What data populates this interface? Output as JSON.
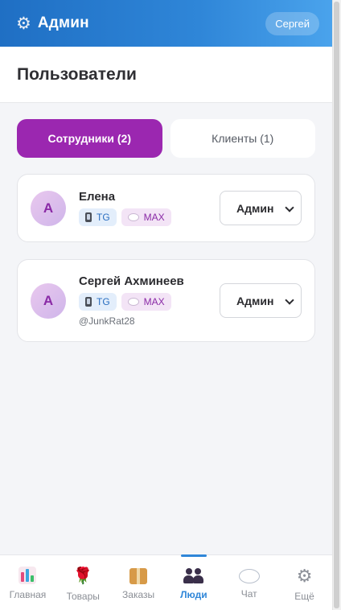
{
  "header": {
    "icon": "gear-icon",
    "title": "Админ",
    "user_label": "Сергей"
  },
  "page": {
    "title": "Пользователи"
  },
  "tabs": [
    {
      "label": "Сотрудники (2)",
      "active": true
    },
    {
      "label": "Клиенты (1)",
      "active": false
    }
  ],
  "users": [
    {
      "avatar_letter": "А",
      "name": "Елена",
      "badges": [
        {
          "icon": "phone-icon",
          "label": "TG"
        },
        {
          "icon": "chat-bubble-icon",
          "label": "MAX"
        }
      ],
      "handle": "",
      "role": "Админ"
    },
    {
      "avatar_letter": "А",
      "name": "Сергей Ахминеев",
      "badges": [
        {
          "icon": "phone-icon",
          "label": "TG"
        },
        {
          "icon": "chat-bubble-icon",
          "label": "MAX"
        }
      ],
      "handle": "@JunkRat28",
      "role": "Админ"
    }
  ],
  "bottom_nav": [
    {
      "label": "Главная",
      "icon": "bar-chart-icon"
    },
    {
      "label": "Товары",
      "icon": "rose-icon"
    },
    {
      "label": "Заказы",
      "icon": "package-icon"
    },
    {
      "label": "Люди",
      "icon": "people-icon",
      "active": true
    },
    {
      "label": "Чат",
      "icon": "chat-icon"
    },
    {
      "label": "Ещё",
      "icon": "gear-icon"
    }
  ],
  "colors": {
    "header_gradient_start": "#1f6fc4",
    "header_gradient_end": "#4aa3ec",
    "accent_purple": "#9b27b0",
    "nav_active": "#2f86d8"
  }
}
